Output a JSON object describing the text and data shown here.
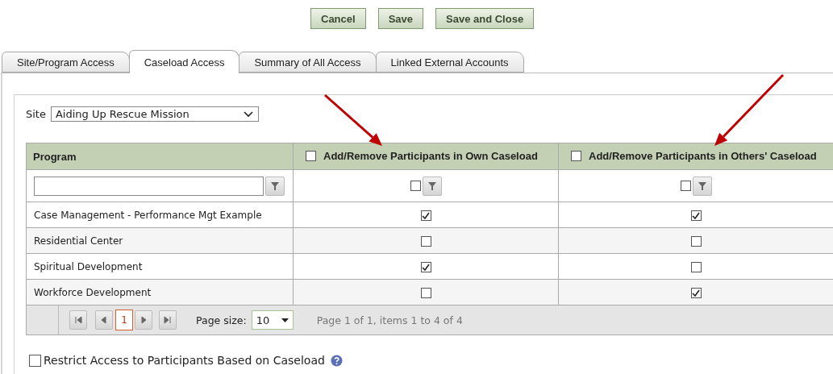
{
  "buttons": [
    "Cancel",
    "Save",
    "Save and Close"
  ],
  "tabs": [
    {
      "label": "Site/Program Access",
      "selected": false
    },
    {
      "label": "Caseload Access",
      "selected": true
    },
    {
      "label": "Summary of All Access",
      "selected": false
    },
    {
      "label": "Linked External Accounts",
      "selected": false
    }
  ],
  "site": {
    "label": "Site",
    "value": "Aiding Up Rescue Mission"
  },
  "table": {
    "columns": [
      {
        "label": "Program"
      },
      {
        "label": "Add/Remove Participants in Own Caseload",
        "checked": false
      },
      {
        "label": "Add/Remove Participants in Others' Caseload",
        "checked": false
      }
    ],
    "filters": [
      {
        "checked": false
      },
      {
        "checked": false
      }
    ],
    "rows": [
      {
        "program": "Case Management - Performance Mgt Example",
        "own": true,
        "others": true
      },
      {
        "program": "Residential Center",
        "own": false,
        "others": false
      },
      {
        "program": "Spiritual Development",
        "own": true,
        "others": false
      },
      {
        "program": "Workforce Development",
        "own": false,
        "others": true
      }
    ]
  },
  "pager": {
    "current": "1",
    "page_size_label": "Page size:",
    "page_size": "10",
    "summary": "Page 1 of 1, items 1 to 4 of 4"
  },
  "restrict": {
    "label": "Restrict Access to Participants Based on Caseload",
    "checked": false
  }
}
